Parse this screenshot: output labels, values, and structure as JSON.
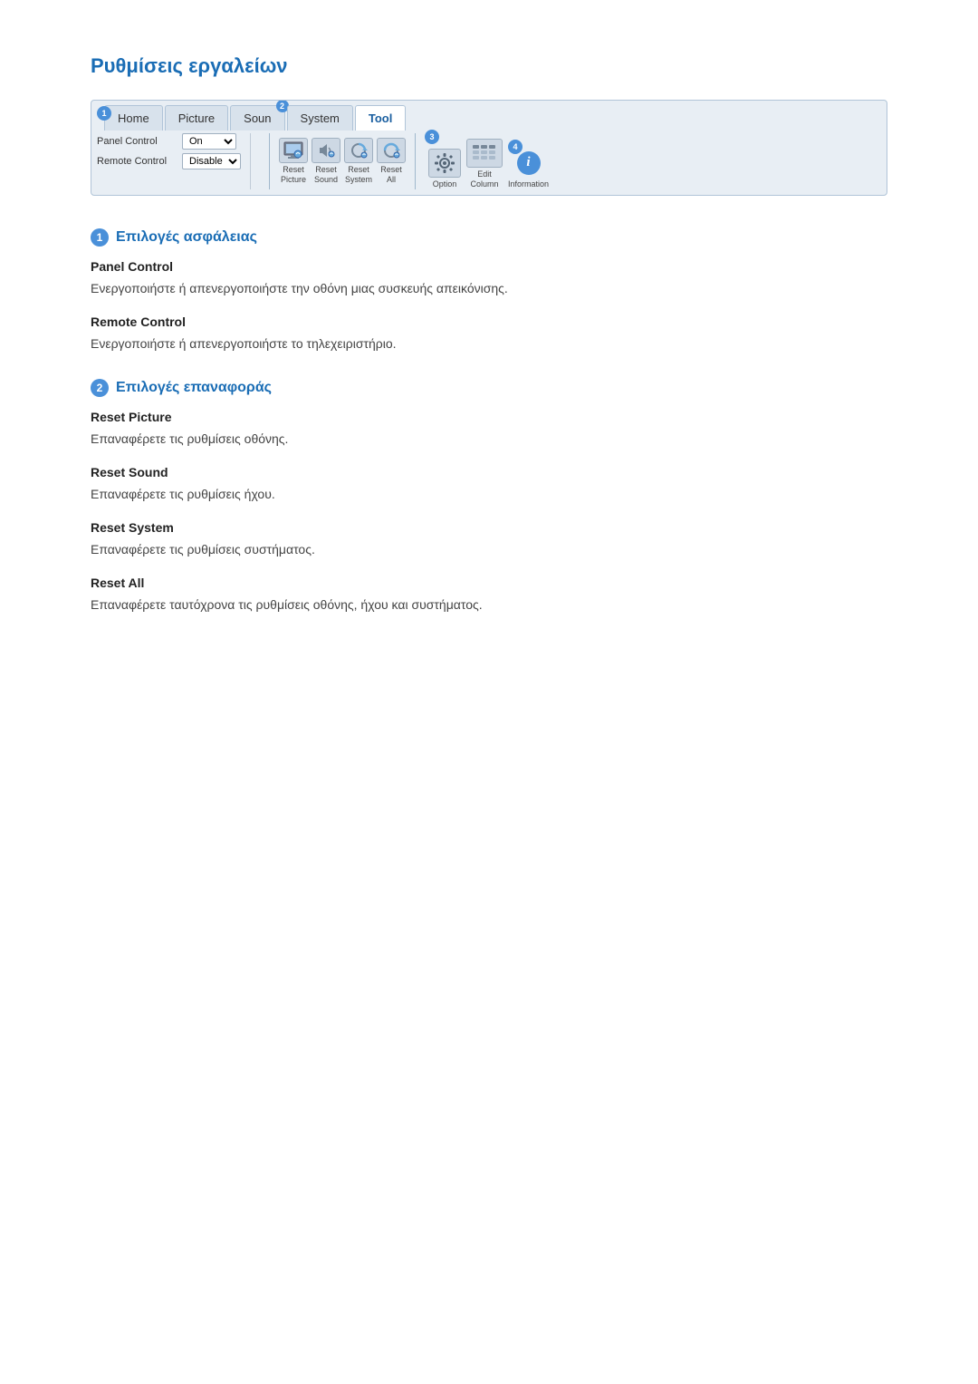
{
  "page": {
    "title": "Ρυθμίσεις εργαλείων"
  },
  "toolbar": {
    "tabs": [
      {
        "id": "home",
        "label": "Home",
        "active": false
      },
      {
        "id": "picture",
        "label": "Picture",
        "active": false
      },
      {
        "id": "sound",
        "label": "Soun",
        "active": false,
        "suffix": "2"
      },
      {
        "id": "system",
        "label": "System",
        "active": false
      },
      {
        "id": "tool",
        "label": "Tool",
        "active": true
      }
    ],
    "badge1": "1",
    "badge2": "2",
    "badge3": "3",
    "badge4": "4",
    "controls": [
      {
        "label": "Panel Control",
        "value": "On"
      },
      {
        "label": "Remote Control",
        "value": "Disable"
      }
    ],
    "reset_buttons": [
      {
        "id": "reset-picture",
        "line1": "Reset",
        "line2": "Picture"
      },
      {
        "id": "reset-sound",
        "line1": "Reset",
        "line2": "Sound"
      },
      {
        "id": "reset-system",
        "line1": "Reset",
        "line2": "System"
      },
      {
        "id": "reset-all",
        "line1": "Reset",
        "line2": "All"
      }
    ],
    "tool_buttons": [
      {
        "id": "option",
        "label": "Option"
      },
      {
        "id": "edit-column",
        "label": "Edit\nColumn"
      },
      {
        "id": "information",
        "label": "Information"
      }
    ]
  },
  "sections": [
    {
      "badge": "1",
      "heading": "Επιλογές ασφάλειας",
      "items": [
        {
          "title": "Panel Control",
          "description": "Ενεργοποιήστε ή απενεργοποιήστε την οθόνη μιας συσκευής απεικόνισης."
        },
        {
          "title": "Remote Control",
          "description": "Ενεργοποιήστε ή απενεργοποιήστε το τηλεχειριστήριο."
        }
      ]
    },
    {
      "badge": "2",
      "heading": "Επιλογές επαναφοράς",
      "items": [
        {
          "title": "Reset Picture",
          "description": "Επαναφέρετε τις ρυθμίσεις οθόνης."
        },
        {
          "title": "Reset Sound",
          "description": "Επαναφέρετε τις ρυθμίσεις ήχου."
        },
        {
          "title": "Reset System",
          "description": "Επαναφέρετε τις ρυθμίσεις συστήματος."
        },
        {
          "title": "Reset All",
          "description": "Επαναφέρετε ταυτόχρονα τις ρυθμίσεις οθόνης, ήχου και συστήματος."
        }
      ]
    }
  ]
}
